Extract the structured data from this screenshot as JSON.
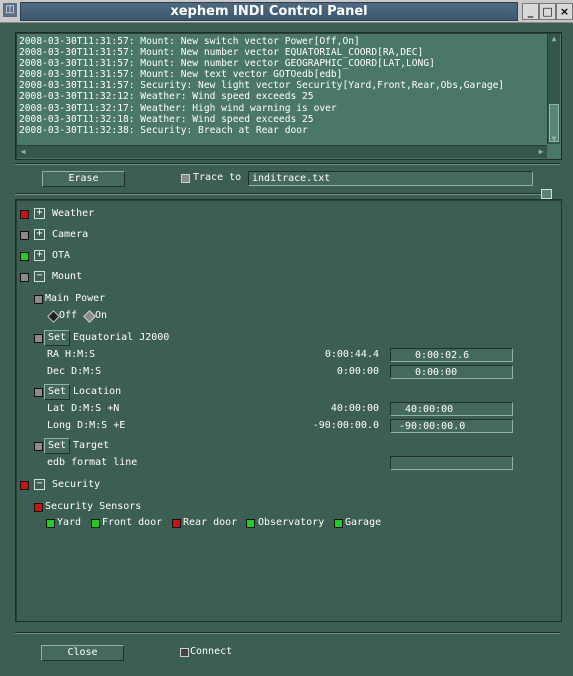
{
  "window": {
    "title": "xephem INDI Control Panel",
    "buttons": {
      "menu": "◫",
      "minimize": "_",
      "maximize": "□",
      "close": "×"
    }
  },
  "log": {
    "lines": [
      "2008-03-30T11:31:57: Mount: New switch vector Power[Off,On]",
      "2008-03-30T11:31:57: Mount: New number vector EQUATORIAL_COORD[RA,DEC]",
      "2008-03-30T11:31:57: Mount: New number vector GEOGRAPHIC_COORD[LAT,LONG]",
      "2008-03-30T11:31:57: Mount: New text vector GOTOedb[edb]",
      "2008-03-30T11:31:57: Security: New light vector Security[Yard,Front,Rear,Obs,Garage]",
      "2008-03-30T11:32:12: Weather: Wind speed exceeds 25",
      "2008-03-30T11:32:17: Weather: High wind warning is over",
      "2008-03-30T11:32:18: Weather: Wind speed exceeds 25",
      "2008-03-30T11:32:38: Security: Breach at Rear door"
    ]
  },
  "toolbar": {
    "erase_label": "Erase",
    "trace_label": "Trace to",
    "trace_file": "inditrace.txt"
  },
  "devices": {
    "weather": {
      "label": "Weather",
      "expander": "+",
      "led_color": "#cc1111"
    },
    "camera": {
      "label": "Camera",
      "expander": "+",
      "led_color": "#8a8a8a"
    },
    "ota": {
      "label": "OTA",
      "expander": "+",
      "led_color": "#22cc22"
    },
    "mount": {
      "label": "Mount",
      "expander": "−",
      "led_color": "#8a8a8a"
    },
    "security": {
      "label": "Security",
      "expander": "−",
      "led_color": "#cc1111"
    }
  },
  "mount": {
    "power": {
      "label": "Main Power",
      "options": [
        {
          "label": "Off",
          "selected": true
        },
        {
          "label": "On",
          "selected": false
        }
      ]
    },
    "equatorial": {
      "set_label": "Set",
      "label": "Equatorial J2000",
      "rows": [
        {
          "label": "RA  H:M:S",
          "current": "0:00:44.4",
          "input": "0:00:02.6"
        },
        {
          "label": "Dec D:M:S",
          "current": "0:00:00",
          "input": "0:00:00"
        }
      ]
    },
    "location": {
      "set_label": "Set",
      "label": "Location",
      "rows": [
        {
          "label": "Lat  D:M:S +N",
          "current": "40:00:00",
          "input": "40:00:00"
        },
        {
          "label": "Long D:M:S +E",
          "current": "-90:00:00.0",
          "input": "-90:00:00.0"
        }
      ]
    },
    "target": {
      "set_label": "Set",
      "label": "Target",
      "rows": [
        {
          "label": "edb format line",
          "current": "",
          "input": ""
        }
      ]
    }
  },
  "security": {
    "sensors_label": "Security Sensors",
    "sensors_led_color": "#cc1111",
    "lights": [
      {
        "label": "Yard",
        "color": "#22cc22"
      },
      {
        "label": "Front door",
        "color": "#22cc22"
      },
      {
        "label": "Rear door",
        "color": "#cc1111"
      },
      {
        "label": "Observatory",
        "color": "#22cc22"
      },
      {
        "label": "Garage",
        "color": "#22cc22"
      }
    ]
  },
  "footer": {
    "close_label": "Close",
    "connect_label": "Connect"
  }
}
